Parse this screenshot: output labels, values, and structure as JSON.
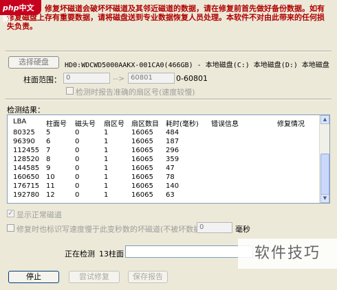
{
  "watermark": {
    "prefix": "php",
    "text": "中文网"
  },
  "warning": {
    "text": "重要提示：修复坏磁道会破坏坏磁道及其邻近磁道的数据，请在修复前首先做好备份数据。如有修复磁盘上存有重要数据，请将磁盘送到专业数据恢复人员处理。本软件不对由此带来的任何损失负责。"
  },
  "disk": {
    "select_button": "选择硬盘",
    "info": "HD0:WDCWD5000AAKX-001CA0(466GB) - 本地磁盘(C:) 本地磁盘(D:) 本地磁盘"
  },
  "range": {
    "label": "柱面范围：",
    "from": "0",
    "arrow": "-->",
    "to": "60801",
    "hint": "0-60801"
  },
  "accurate_check": {
    "label": "检测时报告准确的扇区号(速度较慢)"
  },
  "results": {
    "label": "检测结果：",
    "columns": [
      "LBA",
      "柱面号",
      "磁头号",
      "扇区号",
      "扇区数目",
      "耗时(毫秒)",
      "错误信息",
      "修复情况"
    ],
    "rows": [
      [
        "80325",
        "5",
        "0",
        "1",
        "16065",
        "484"
      ],
      [
        "96390",
        "6",
        "0",
        "1",
        "16065",
        "187"
      ],
      [
        "112455",
        "7",
        "0",
        "1",
        "16065",
        "296"
      ],
      [
        "128520",
        "8",
        "0",
        "1",
        "16065",
        "359"
      ],
      [
        "144585",
        "9",
        "0",
        "1",
        "16065",
        "47"
      ],
      [
        "160650",
        "10",
        "0",
        "1",
        "16065",
        "78"
      ],
      [
        "176715",
        "11",
        "0",
        "1",
        "16065",
        "140"
      ],
      [
        "192780",
        "12",
        "0",
        "1",
        "16065",
        "63"
      ]
    ]
  },
  "show_normal": {
    "label": "显示正常磁道",
    "checked": "✓"
  },
  "repair_slow": {
    "label": "修复时也标识写速度慢于此变秒数的坏磁道(不被坏数据)",
    "value": "0",
    "unit": "毫秒"
  },
  "status": {
    "label": "正在检测",
    "value": "13柱面"
  },
  "buttons": {
    "stop": "停止",
    "try_repair": "尝试修复",
    "save_report": "保存报告"
  },
  "corner_watermark": "软件技巧"
}
